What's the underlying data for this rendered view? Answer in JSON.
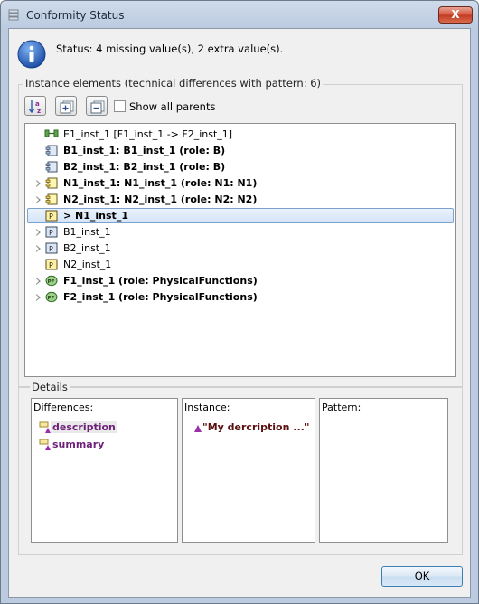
{
  "window": {
    "title": "Conformity Status",
    "close_label": "X"
  },
  "status": {
    "text": "Status: 4 missing value(s), 2 extra value(s)."
  },
  "instance_elements": {
    "label": "Instance elements (technical differences with pattern: 6)",
    "show_all_parents_label": "Show all parents",
    "show_all_parents_checked": false,
    "rows": [
      {
        "text": "E1_inst_1 [F1_inst_1 -> F2_inst_1]",
        "icon": "exchange-icon",
        "bold": false,
        "expandable": false,
        "selected": false
      },
      {
        "text": "B1_inst_1: B1_inst_1  (role: B)",
        "icon": "component-icon",
        "bold": true,
        "expandable": false,
        "selected": false
      },
      {
        "text": "B2_inst_1: B2_inst_1  (role: B)",
        "icon": "component-icon",
        "bold": true,
        "expandable": false,
        "selected": false
      },
      {
        "text": "N1_inst_1: N1_inst_1  (role: N1: N1)",
        "icon": "node-component-icon",
        "bold": true,
        "expandable": true,
        "selected": false
      },
      {
        "text": "N2_inst_1: N2_inst_1  (role: N2: N2)",
        "icon": "node-component-icon",
        "bold": true,
        "expandable": true,
        "selected": false
      },
      {
        "text": "> N1_inst_1",
        "icon": "part-icon-yellow",
        "bold": true,
        "expandable": false,
        "selected": true
      },
      {
        "text": "B1_inst_1",
        "icon": "part-icon-blue",
        "bold": false,
        "expandable": true,
        "selected": false
      },
      {
        "text": "B2_inst_1",
        "icon": "part-icon-blue",
        "bold": false,
        "expandable": true,
        "selected": false
      },
      {
        "text": "N2_inst_1",
        "icon": "part-icon-yellow",
        "bold": false,
        "expandable": false,
        "selected": false
      },
      {
        "text": "F1_inst_1  (role: PhysicalFunctions)",
        "icon": "function-icon",
        "bold": true,
        "expandable": true,
        "selected": false
      },
      {
        "text": "F2_inst_1  (role: PhysicalFunctions)",
        "icon": "function-icon",
        "bold": true,
        "expandable": true,
        "selected": false
      }
    ]
  },
  "details": {
    "label": "Details",
    "differences": {
      "title": "Differences:",
      "items": [
        "description",
        "summary"
      ]
    },
    "instance": {
      "title": "Instance:",
      "items": [
        "\"My dercription ...\""
      ]
    },
    "pattern": {
      "title": "Pattern:",
      "items": []
    }
  },
  "buttons": {
    "ok_label": "OK"
  },
  "colors": {
    "selection_border": "#7da2ce",
    "difference_text": "#6e1f7a",
    "instance_text": "#5a1010"
  }
}
